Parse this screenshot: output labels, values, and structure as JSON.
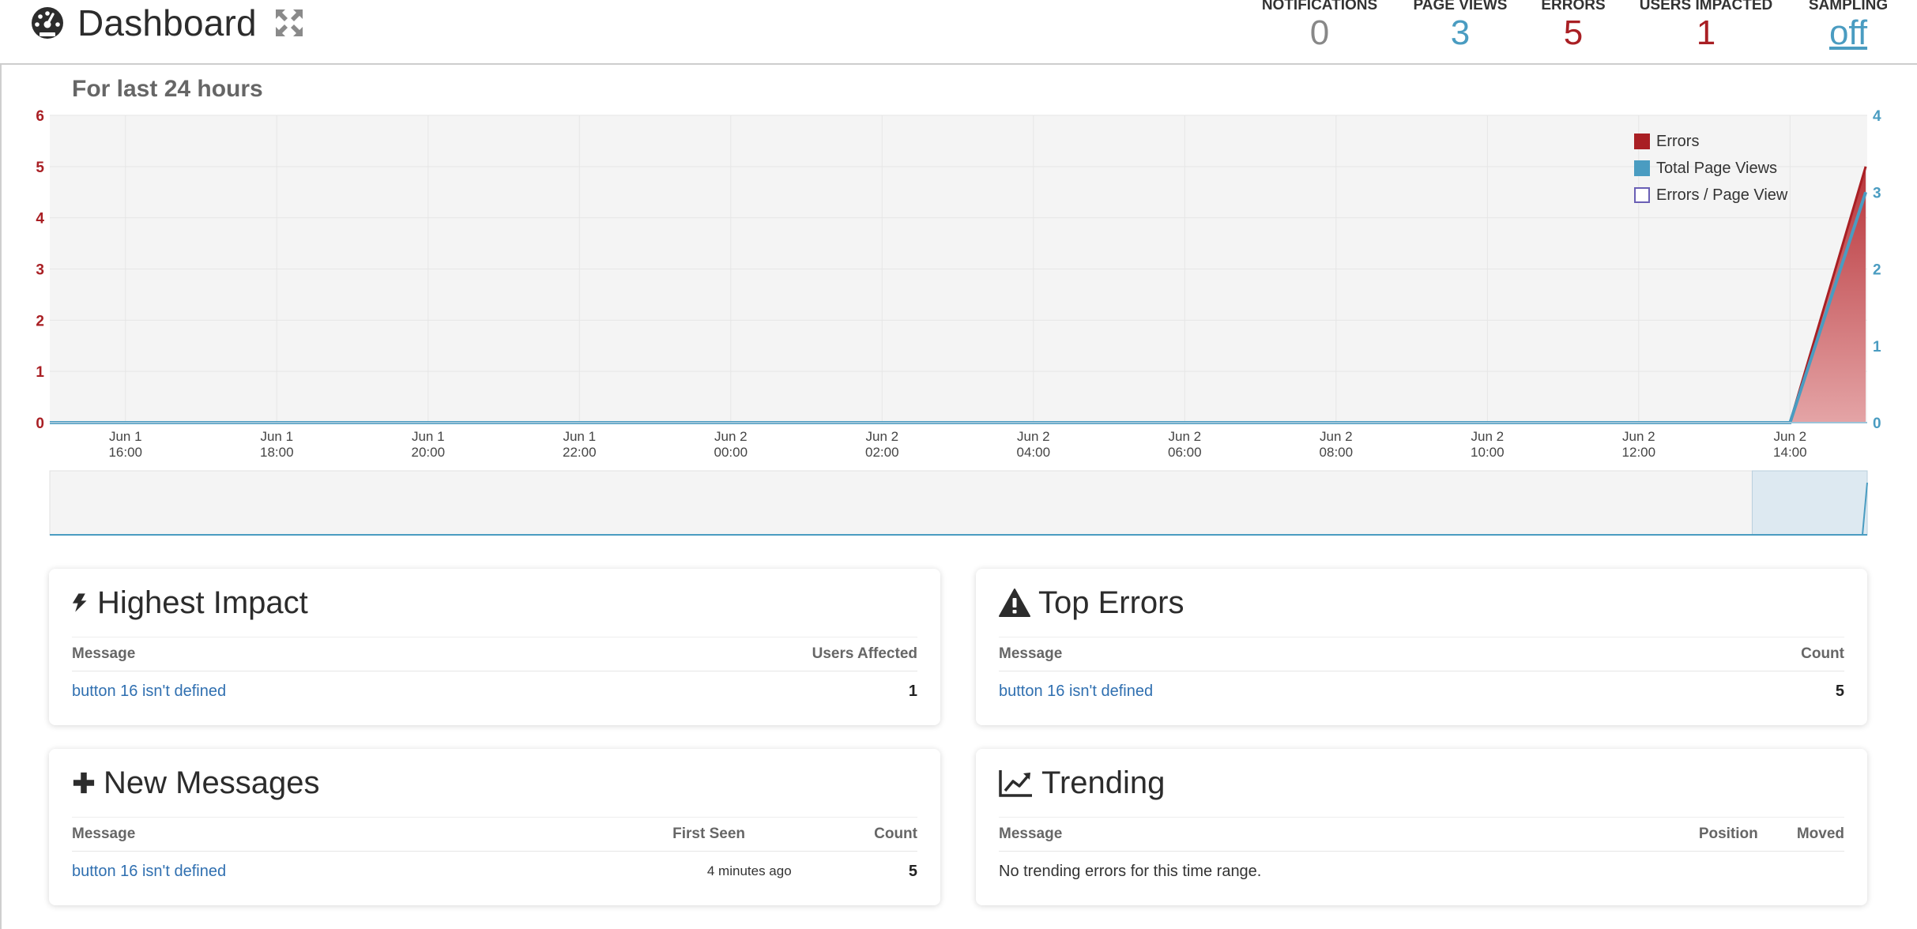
{
  "header": {
    "title": "Dashboard",
    "icons": {
      "title": "dashboard-gauge-icon",
      "expand": "expand-arrows-icon"
    },
    "stats": [
      {
        "label": "NOTIFICATIONS",
        "value": "0",
        "color": "#888888"
      },
      {
        "label": "PAGE VIEWS",
        "value": "3",
        "color": "#4a9cc1"
      },
      {
        "label": "ERRORS",
        "value": "5",
        "color": "#a91f24"
      },
      {
        "label": "USERS IMPACTED",
        "value": "1",
        "color": "#a91f24"
      },
      {
        "label": "SAMPLING",
        "value": "off",
        "color": "#4a9cc1",
        "underlined": true
      }
    ]
  },
  "chart_subtitle": "For last 24 hours",
  "chart_data": {
    "type": "area",
    "x_ticks": [
      [
        "Jun 1",
        "16:00"
      ],
      [
        "Jun 1",
        "18:00"
      ],
      [
        "Jun 1",
        "20:00"
      ],
      [
        "Jun 1",
        "22:00"
      ],
      [
        "Jun 2",
        "00:00"
      ],
      [
        "Jun 2",
        "02:00"
      ],
      [
        "Jun 2",
        "04:00"
      ],
      [
        "Jun 2",
        "06:00"
      ],
      [
        "Jun 2",
        "08:00"
      ],
      [
        "Jun 2",
        "10:00"
      ],
      [
        "Jun 2",
        "12:00"
      ],
      [
        "Jun 2",
        "14:00"
      ]
    ],
    "x_range_hours": [
      15,
      39.02
    ],
    "y_left": {
      "ticks": [
        "0",
        "1",
        "2",
        "3",
        "4",
        "5",
        "6"
      ],
      "range": [
        0,
        6
      ],
      "color": "#a91f24"
    },
    "y_right": {
      "ticks": [
        "0",
        "1",
        "2",
        "3",
        "4"
      ],
      "range": [
        0,
        4
      ],
      "color": "#4a9cc1"
    },
    "series": [
      {
        "name": "Errors",
        "color": "#a91f24",
        "axis": "left",
        "points": [
          [
            15,
            0
          ],
          [
            38,
            0
          ],
          [
            39,
            5
          ]
        ]
      },
      {
        "name": "Total Page Views",
        "color": "#4a9cc1",
        "axis": "right",
        "points": [
          [
            15,
            0
          ],
          [
            38,
            0
          ],
          [
            39,
            3
          ]
        ]
      },
      {
        "name": "Errors / Page View",
        "color": "#6a5fb5",
        "axis": "none",
        "points": []
      }
    ],
    "grid": true,
    "legend_position": "top-right",
    "navigator_selection_hours": [
      37.5,
      39.02
    ]
  },
  "panels": {
    "highest_impact": {
      "title": "Highest Impact",
      "icon": "lightning-bolt-icon",
      "columns": [
        "Message",
        "Users Affected"
      ],
      "rows": [
        {
          "message": "button 16 isn't defined",
          "value": "1"
        }
      ]
    },
    "top_errors": {
      "title": "Top Errors",
      "icon": "warning-triangle-icon",
      "columns": [
        "Message",
        "Count"
      ],
      "rows": [
        {
          "message": "button 16 isn't defined",
          "value": "5"
        }
      ]
    },
    "new_messages": {
      "title": "New Messages",
      "icon": "plus-icon",
      "columns": [
        "Message",
        "First Seen",
        "Count"
      ],
      "rows": [
        {
          "message": "button 16 isn't defined",
          "first_seen": "4 minutes ago",
          "value": "5"
        }
      ]
    },
    "trending": {
      "title": "Trending",
      "icon": "line-chart-icon",
      "columns": [
        "Message",
        "Position",
        "Moved"
      ],
      "empty_text": "No trending errors for this time range."
    }
  }
}
